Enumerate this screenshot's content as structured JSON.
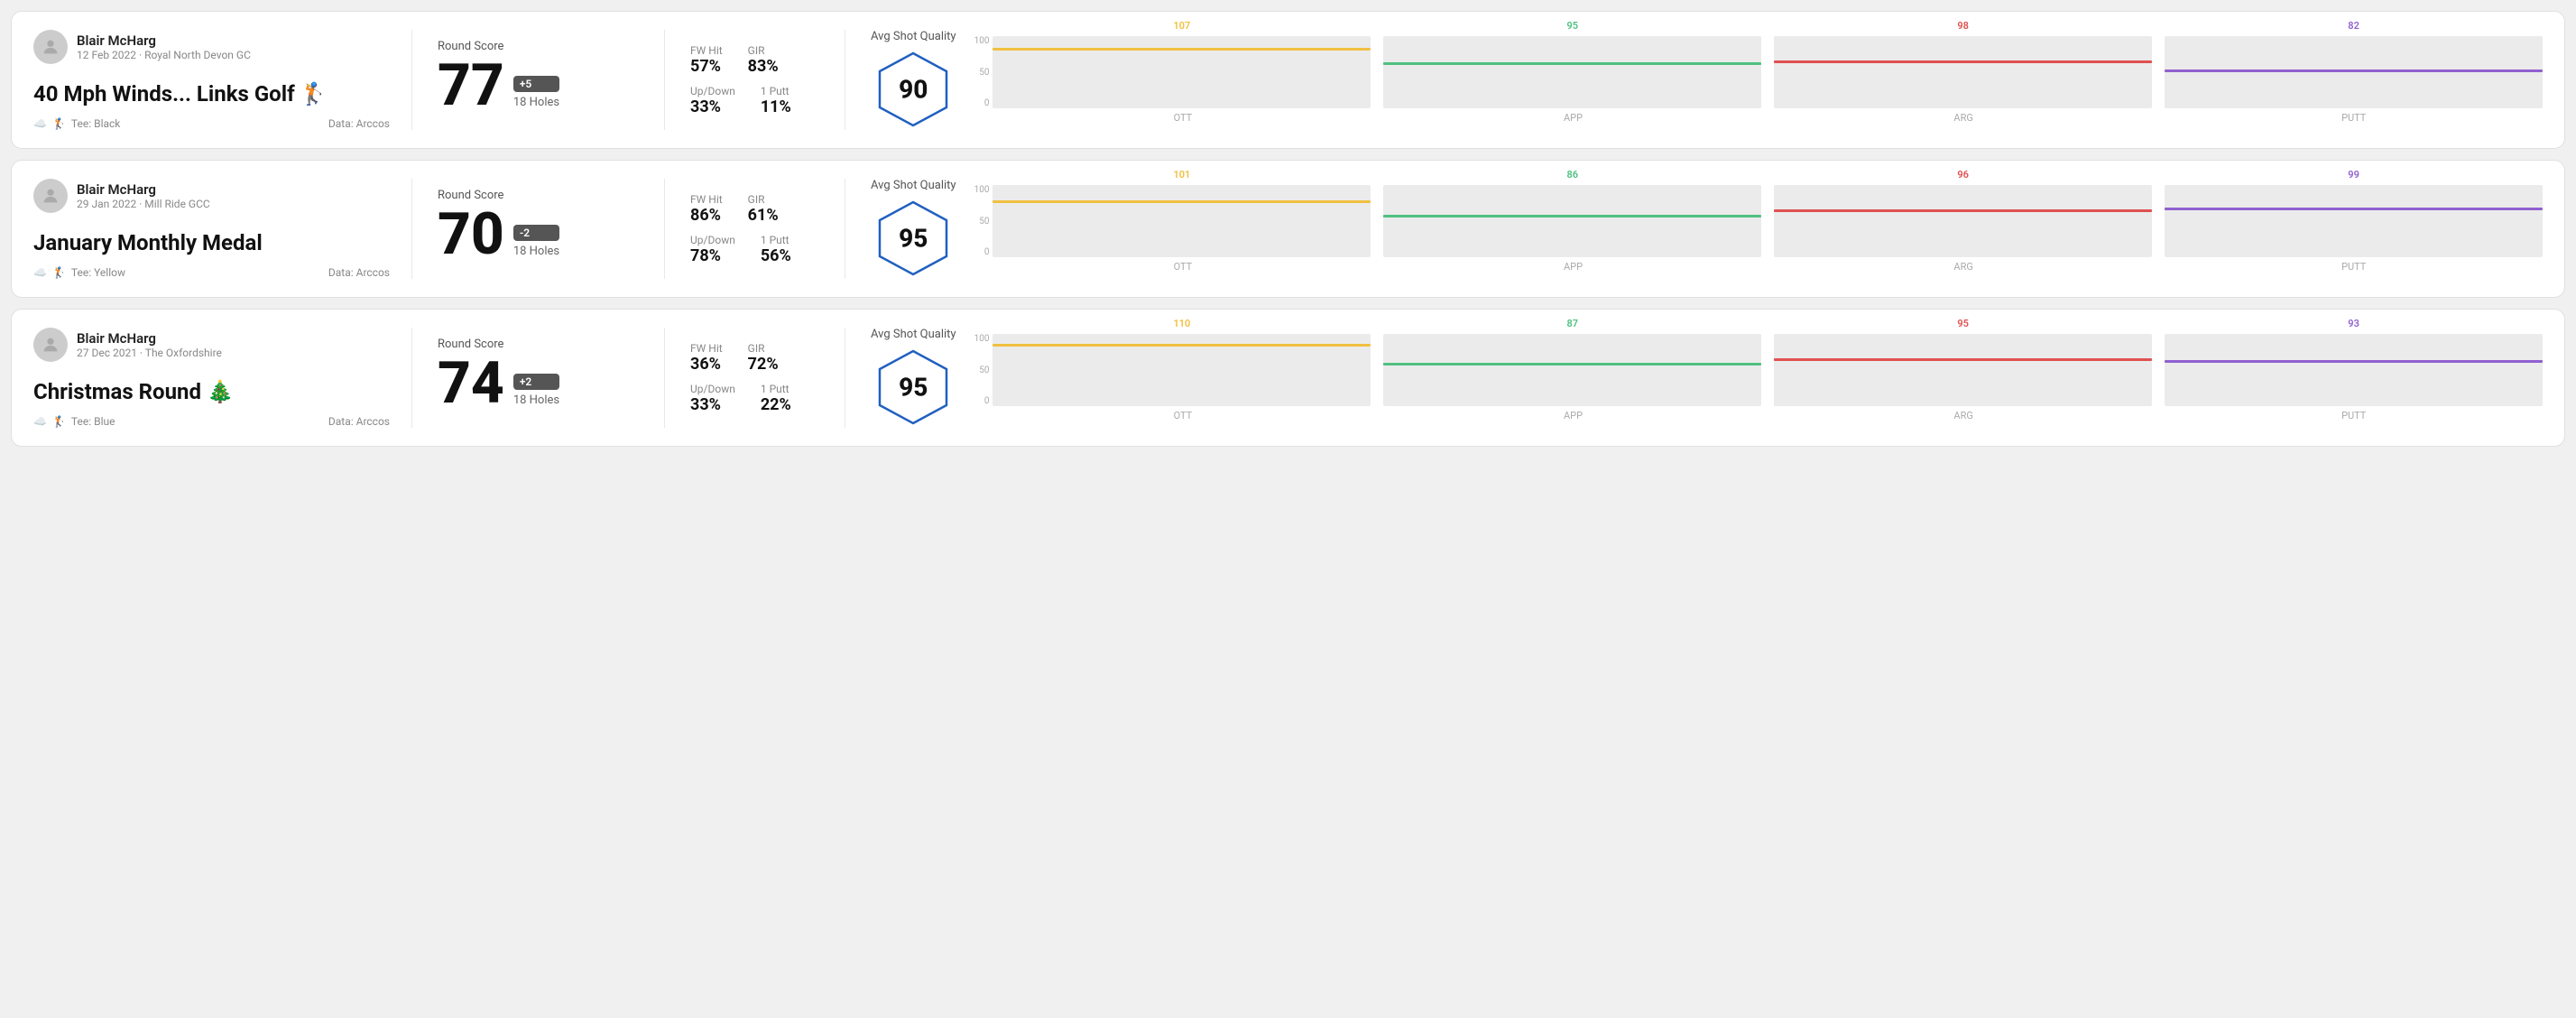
{
  "rounds": [
    {
      "id": "round1",
      "user": {
        "name": "Blair McHarg",
        "date": "12 Feb 2022",
        "course": "Royal North Devon GC"
      },
      "title": "40 Mph Winds... Links Golf 🏌",
      "tee": "Black",
      "data_source": "Arccos",
      "score": "77",
      "score_diff": "+5",
      "holes": "18 Holes",
      "fw_hit": "57%",
      "gir": "83%",
      "up_down": "33%",
      "one_putt": "11%",
      "avg_quality": "90",
      "bar_data": [
        {
          "label": "OTT",
          "value": 107,
          "color": "#f0c040",
          "percent": 80
        },
        {
          "label": "APP",
          "value": 95,
          "color": "#50c080",
          "percent": 60
        },
        {
          "label": "ARG",
          "value": 98,
          "color": "#e05050",
          "percent": 63
        },
        {
          "label": "PUTT",
          "value": 82,
          "color": "#9060d0",
          "percent": 50
        }
      ]
    },
    {
      "id": "round2",
      "user": {
        "name": "Blair McHarg",
        "date": "29 Jan 2022",
        "course": "Mill Ride GCC"
      },
      "title": "January Monthly Medal",
      "tee": "Yellow",
      "data_source": "Arccos",
      "score": "70",
      "score_diff": "-2",
      "holes": "18 Holes",
      "fw_hit": "86%",
      "gir": "61%",
      "up_down": "78%",
      "one_putt": "56%",
      "avg_quality": "95",
      "bar_data": [
        {
          "label": "OTT",
          "value": 101,
          "color": "#f0c040",
          "percent": 75
        },
        {
          "label": "APP",
          "value": 86,
          "color": "#50c080",
          "percent": 55
        },
        {
          "label": "ARG",
          "value": 96,
          "color": "#e05050",
          "percent": 62
        },
        {
          "label": "PUTT",
          "value": 99,
          "color": "#9060d0",
          "percent": 65
        }
      ]
    },
    {
      "id": "round3",
      "user": {
        "name": "Blair McHarg",
        "date": "27 Dec 2021",
        "course": "The Oxfordshire"
      },
      "title": "Christmas Round 🎄",
      "tee": "Blue",
      "data_source": "Arccos",
      "score": "74",
      "score_diff": "+2",
      "holes": "18 Holes",
      "fw_hit": "36%",
      "gir": "72%",
      "up_down": "33%",
      "one_putt": "22%",
      "avg_quality": "95",
      "bar_data": [
        {
          "label": "OTT",
          "value": 110,
          "color": "#f0c040",
          "percent": 82
        },
        {
          "label": "APP",
          "value": 87,
          "color": "#50c080",
          "percent": 56
        },
        {
          "label": "ARG",
          "value": 95,
          "color": "#e05050",
          "percent": 62
        },
        {
          "label": "PUTT",
          "value": 93,
          "color": "#9060d0",
          "percent": 60
        }
      ]
    }
  ],
  "labels": {
    "round_score": "Round Score",
    "fw_hit": "FW Hit",
    "gir": "GIR",
    "up_down": "Up/Down",
    "one_putt": "1 Putt",
    "avg_shot_quality": "Avg Shot Quality",
    "tee_prefix": "Tee:",
    "data_prefix": "Data:",
    "y_axis": [
      "100",
      "50",
      "0"
    ]
  }
}
